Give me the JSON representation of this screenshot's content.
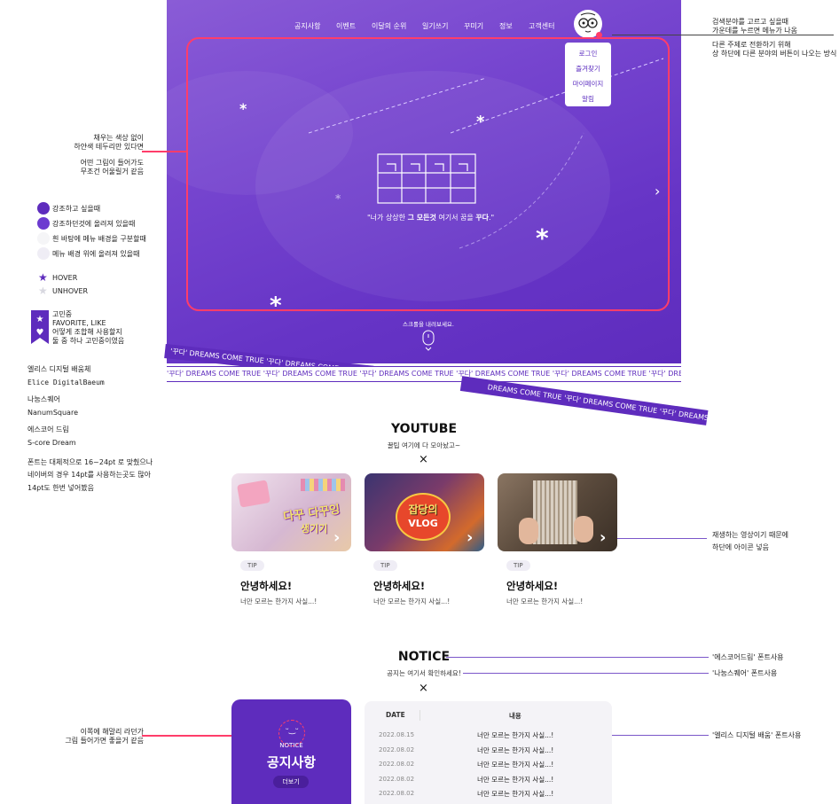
{
  "nav": {
    "items": [
      "공지사항",
      "이벤트",
      "이달의 순위",
      "일기쓰기",
      "꾸미기",
      "정보",
      "고객센터"
    ]
  },
  "dropdown": {
    "items": [
      "로그인",
      "즐겨찾기",
      "마이페이지",
      "알림"
    ]
  },
  "hero": {
    "quote_pre": "\"너가 상상한 ",
    "quote_bold1": "그 모든것",
    "quote_mid": " 여기서 꿈을 ",
    "quote_bold2": "꾸다",
    "quote_post": ".\"",
    "scroll_hint": "스크롤을 내려보세요.",
    "next_arrow": "›"
  },
  "ribbon": {
    "unit_a": "'꾸다'",
    "unit_b": "DREAMS COME TRUE",
    "tilted_text": "'꾸다'    DREAMS COME TRUE    '꾸다'    DREAMS COME TRUE    '꾸다'    DREAMS COME TRUE",
    "flat_text": "'꾸다'    DREAMS COME TRUE    '꾸다'    DREAMS COME TRUE    '꾸다'    DREAMS COME TRUE    '꾸다'    DREAMS COME TRUE    '꾸다'    DREAMS COME TRUE    '꾸다'    DREAMS COME TRUE",
    "lower_text": "DREAMS COME TRUE    '꾸다'    DREAMS COME TRUE    '꾸다'    DREAMS COME TRUE"
  },
  "left_notes": {
    "frame_note": [
      "채우는 색상 없이",
      "하얀색 테두리만 있다면",
      "",
      "어떤 그림이 들어가도",
      "무조건 어울릴거 같음"
    ],
    "legend": [
      "강조하고 싶을때",
      "강조하던것에 올려져 있을때",
      "흰 바탕에 메뉴 배경을 구분할때",
      "메뉴 배경 위에 올려져 있을때"
    ],
    "star_hover": "HOVER",
    "star_unhover": "UNHOVER",
    "bookmark_note": [
      "고민중",
      "FAVORITE, LIKE",
      "어떻게 조합해 사용할지",
      "둘 중 하나 고민중이였음"
    ],
    "fonts": [
      {
        "name": "엘리스 디지털 배움체",
        "sample": "Elice DigitalBaeum"
      },
      {
        "name": "나눔스퀘어",
        "sample": "NanumSquare"
      },
      {
        "name": "에스코어 드림",
        "sample": "S-core Dream"
      }
    ],
    "font_note": [
      "폰트는 대체적으로 16~24pt 로 맞췄으나",
      "네이버의 경우 14pt를 사용하는곳도 많아",
      "14pt도 한번 넣어봤음"
    ],
    "notice_note": [
      "이쪽에 해말리 라던가",
      "그림 들어가면 좋을거 같음"
    ]
  },
  "right_notes": {
    "menu_note": [
      "검색분야를 고르고 싶을때",
      "가운데를 누르면 메뉴가 나옴",
      "",
      "다른 주제로 전환하기 위해",
      "상 하단에 다른 분야의 버튼이 나오는 방식"
    ],
    "video_note": [
      "재생하는 영상이기 때문에",
      "하단에 아이콘 넣음"
    ],
    "font_title": "'에스코어드림' 폰트사용",
    "font_sub": "'나눔스퀘어' 폰트사용",
    "font_list": "'엘리스 디지털 배움' 폰트사용"
  },
  "youtube": {
    "title": "YOUTUBE",
    "subtitle": "꿀팁 여기에 다 모아놨고~",
    "close": "×",
    "cards": [
      {
        "tag": "TIP",
        "title": "안녕하세요!",
        "desc": "너만 모르는 한가지 사실...!",
        "thumb_text": [
          "다꾸 다꾸잉",
          "생기기"
        ],
        "colors": [
          "#e9d8e6",
          "#c9a7c8"
        ]
      },
      {
        "tag": "TIP",
        "title": "안녕하세요!",
        "desc": "너만 모르는 한가지 사실...!",
        "thumb_text": [
          "잡당의",
          "VLOG"
        ],
        "colors": [
          "#2a2e5a",
          "#c24d2c"
        ]
      },
      {
        "tag": "TIP",
        "title": "안녕하세요!",
        "desc": "너만 모르는 한가지 사실...!",
        "thumb_text": [
          "",
          ""
        ],
        "colors": [
          "#6c5a4a",
          "#3a2f26"
        ]
      }
    ]
  },
  "notice": {
    "title": "NOTICE",
    "subtitle": "공지는 여기서 확인하세요!",
    "close": "×",
    "card_label_small": "NOTICE",
    "card_title": "공지사항",
    "more": "더보기",
    "table_head": {
      "date": "DATE",
      "content": "내용"
    },
    "rows": [
      {
        "date": "2022.08.15",
        "text": "너만 모르는 한가지 사실...!"
      },
      {
        "date": "2022.08.02",
        "text": "너만 모르는 한가지 사실...!"
      },
      {
        "date": "2022.08.02",
        "text": "너만 모르는 한가지 사실...!"
      },
      {
        "date": "2022.08.02",
        "text": "너만 모르는 한가지 사실...!"
      },
      {
        "date": "2022.08.02",
        "text": "너만 모르는 한가지 사실...!"
      }
    ]
  },
  "colors": {
    "primary": "#5e2cbd",
    "accent": "#ff3d6a",
    "light": "#efedf5"
  }
}
